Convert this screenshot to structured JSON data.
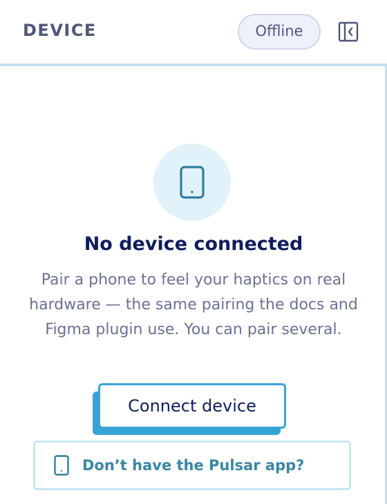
{
  "header": {
    "title": "DEVICE",
    "status": "Offline"
  },
  "icons": {
    "collapse": "sidebar-collapse-icon",
    "phone": "phone-icon"
  },
  "empty_state": {
    "title": "No device connected",
    "description": "Pair a phone to feel your haptics on real hardware — the same pairing the docs and Figma plugin use. You can pair several.",
    "connect_label": "Connect device",
    "app_link_label": "Don’t have the Pulsar app?"
  },
  "colors": {
    "title_text": "#0f1d5e",
    "muted_text": "#6b7094",
    "accent": "#37a4d6",
    "icon_teal": "#2f7e9c",
    "divider": "#c3e1ec",
    "pill_bg": "#eef0fb"
  }
}
